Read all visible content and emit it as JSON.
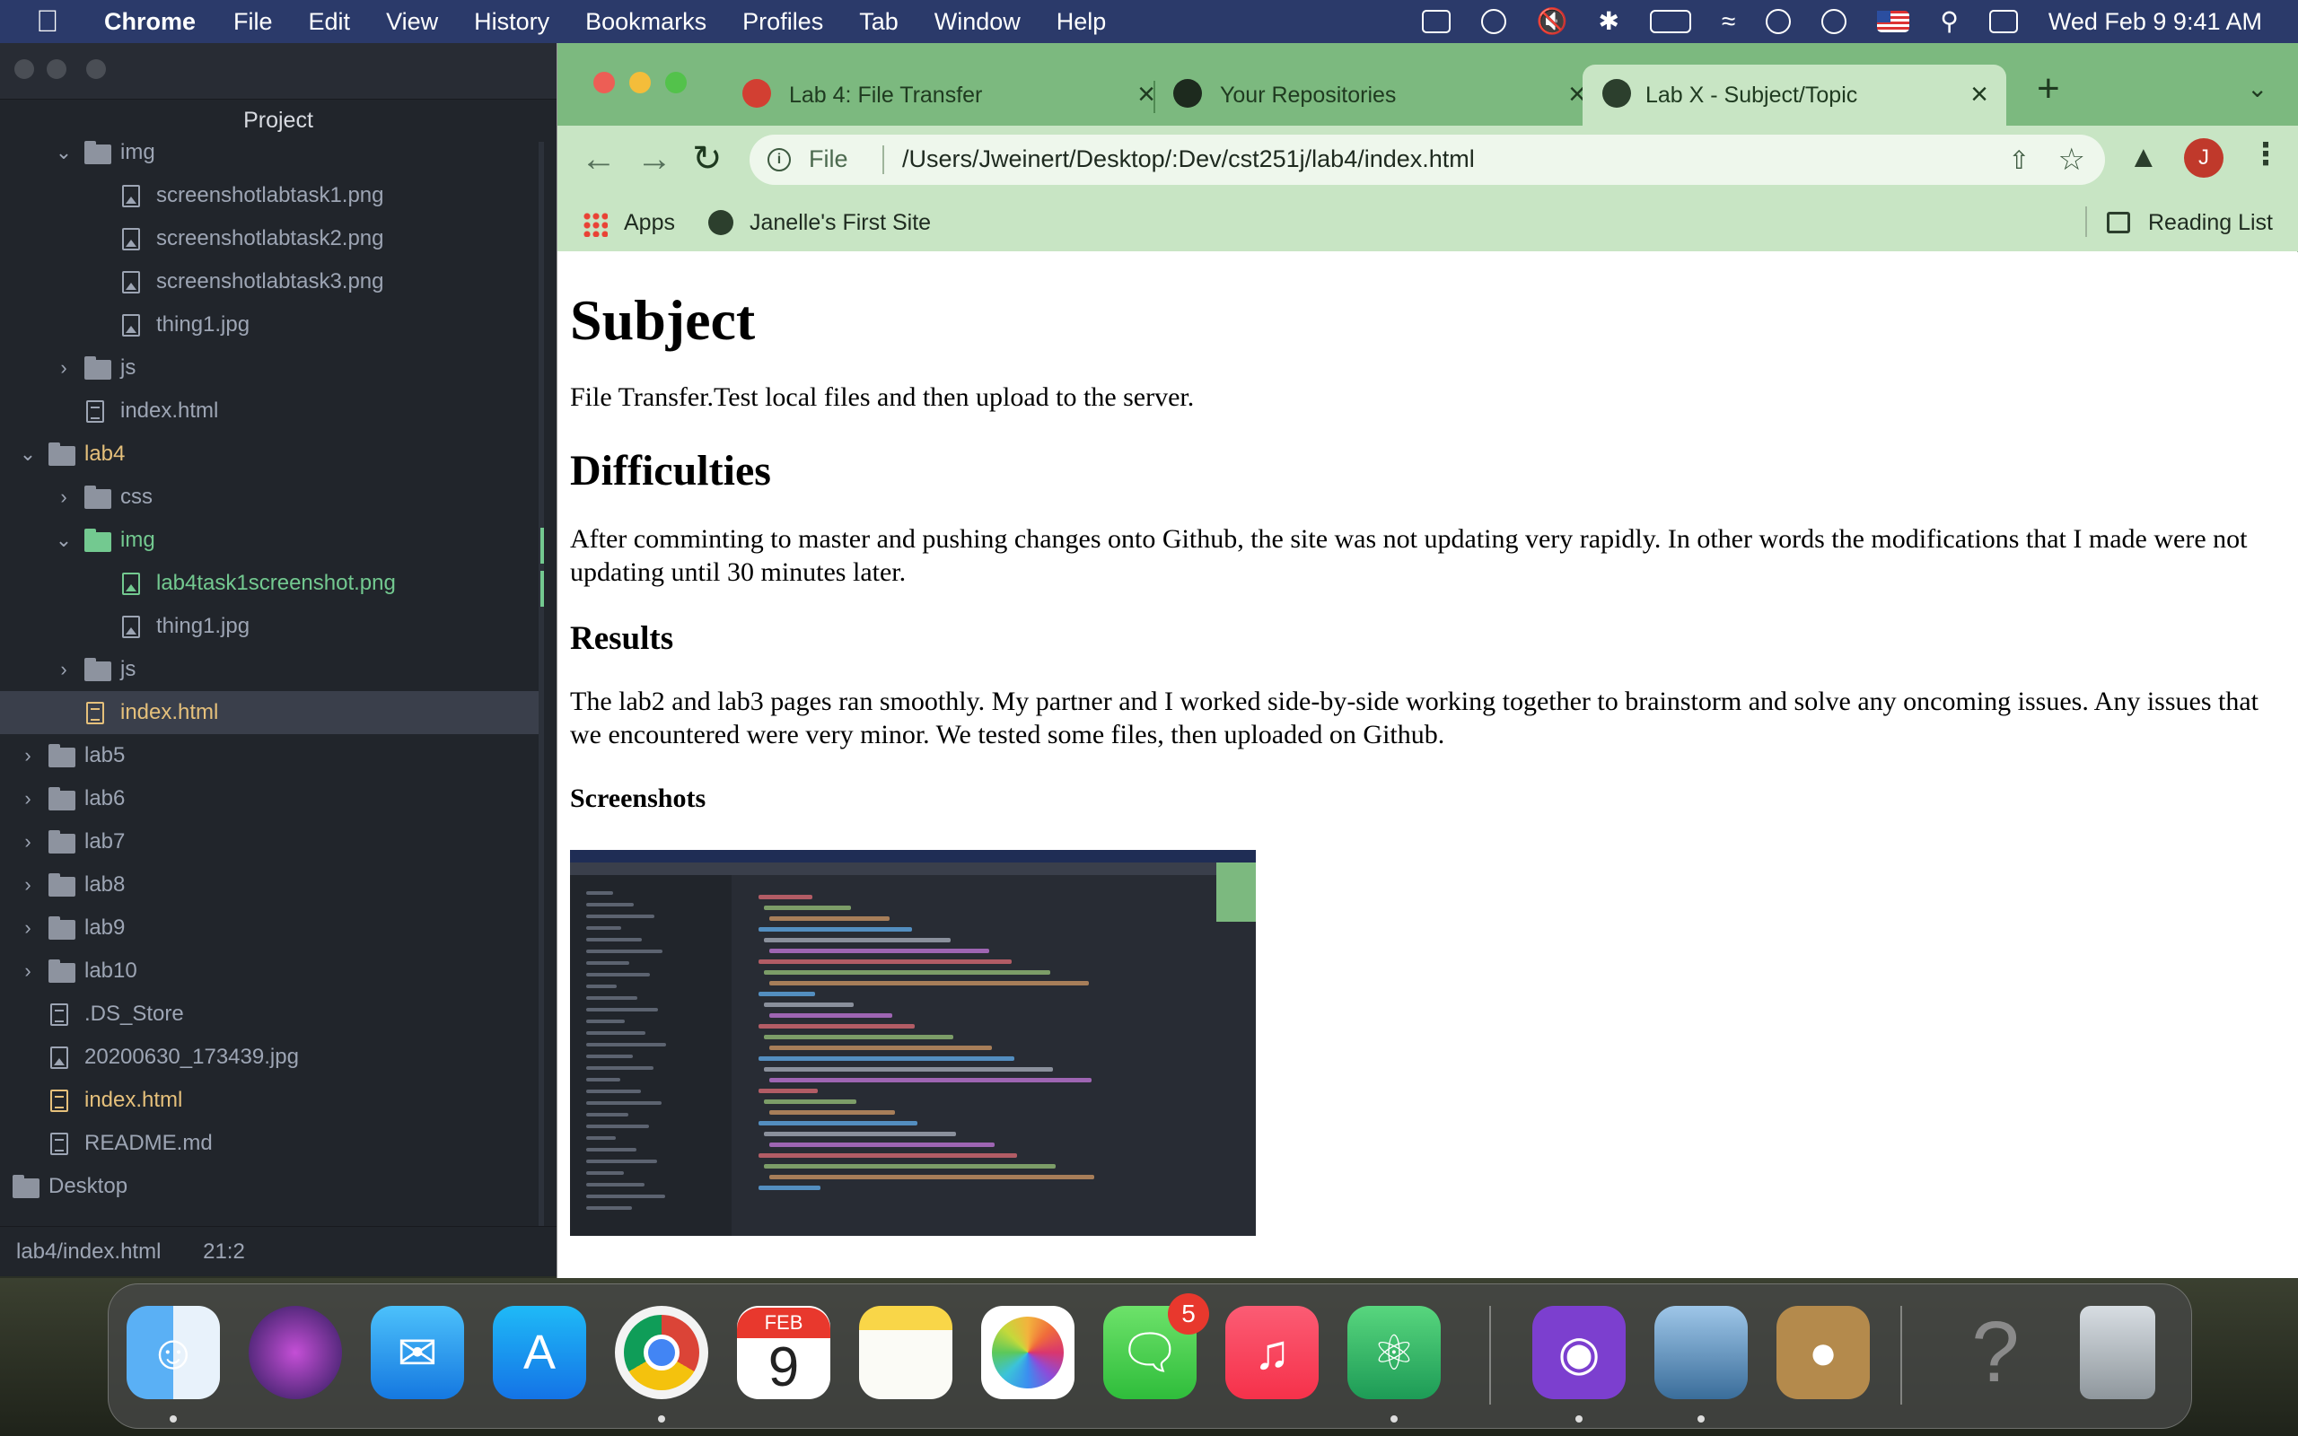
{
  "menubar": {
    "app_name": "Chrome",
    "items": [
      "File",
      "Edit",
      "View",
      "History",
      "Bookmarks",
      "Profiles",
      "Tab",
      "Window",
      "Help"
    ],
    "clock": "Wed Feb 9  9:41 AM"
  },
  "atom": {
    "panel_title": "Project",
    "tree": [
      {
        "label": "img",
        "kind": "folder",
        "depth": 1,
        "expanded": true
      },
      {
        "label": "screenshotlabtask1.png",
        "kind": "image",
        "depth": 2
      },
      {
        "label": "screenshotlabtask2.png",
        "kind": "image",
        "depth": 2
      },
      {
        "label": "screenshotlabtask3.png",
        "kind": "image",
        "depth": 2
      },
      {
        "label": "thing1.jpg",
        "kind": "image",
        "depth": 2
      },
      {
        "label": "js",
        "kind": "folder",
        "depth": 1,
        "expanded": false
      },
      {
        "label": "index.html",
        "kind": "text",
        "depth": 1
      },
      {
        "label": "lab4",
        "kind": "folder",
        "depth": 0,
        "expanded": true,
        "status": "modified"
      },
      {
        "label": "css",
        "kind": "folder",
        "depth": 1,
        "expanded": false
      },
      {
        "label": "img",
        "kind": "folder",
        "depth": 1,
        "expanded": true,
        "status": "added"
      },
      {
        "label": "lab4task1screenshot.png",
        "kind": "image",
        "depth": 2,
        "status": "added"
      },
      {
        "label": "thing1.jpg",
        "kind": "image",
        "depth": 2
      },
      {
        "label": "js",
        "kind": "folder",
        "depth": 1,
        "expanded": false
      },
      {
        "label": "index.html",
        "kind": "text",
        "depth": 1,
        "status": "modified",
        "selected": true
      },
      {
        "label": "lab5",
        "kind": "folder",
        "depth": 0,
        "expanded": false
      },
      {
        "label": "lab6",
        "kind": "folder",
        "depth": 0,
        "expanded": false
      },
      {
        "label": "lab7",
        "kind": "folder",
        "depth": 0,
        "expanded": false
      },
      {
        "label": "lab8",
        "kind": "folder",
        "depth": 0,
        "expanded": false
      },
      {
        "label": "lab9",
        "kind": "folder",
        "depth": 0,
        "expanded": false
      },
      {
        "label": "lab10",
        "kind": "folder",
        "depth": 0,
        "expanded": false
      },
      {
        "label": ".DS_Store",
        "kind": "text",
        "depth": 0
      },
      {
        "label": "20200630_173439.jpg",
        "kind": "image",
        "depth": 0
      },
      {
        "label": "index.html",
        "kind": "text",
        "depth": 0,
        "status": "modified"
      },
      {
        "label": "README.md",
        "kind": "readme",
        "depth": 0
      },
      {
        "label": "Desktop",
        "kind": "folder",
        "depth": -1,
        "expanded": true
      }
    ],
    "status_path": "lab4/index.html",
    "cursor_pos": "21:2"
  },
  "chrome": {
    "tabs": [
      {
        "label": "Lab 4: File Transfer",
        "active": false,
        "icon": "red-gear-icon"
      },
      {
        "label": "Your Repositories",
        "active": false,
        "icon": "github-icon"
      },
      {
        "label": "Lab X - Subject/Topic",
        "active": true,
        "icon": "globe-icon"
      }
    ],
    "omnibox": {
      "scheme": "File",
      "url": "/Users/Jweinert/Desktop/:Dev/cst251j/lab4/index.html"
    },
    "profile_initial": "J",
    "bookmarks": [
      "Apps",
      "Janelle's First Site"
    ],
    "reading_list": "Reading List"
  },
  "page": {
    "h1": "Subject",
    "p1": "File Transfer.Test local files and then upload to the server.",
    "h2": "Difficulties",
    "p2": "After comminting to master and pushing changes onto Github, the site was not updating very rapidly. In other words the modifications that I made were not updating until 30 minutes later.",
    "h3": "Results",
    "p3": "The lab2 and lab3 pages ran smoothly. My partner and I worked side-by-side working together to brainstorm and solve any oncoming issues. Any issues that we encountered were very minor. We tested some files, then uploaded on Github.",
    "h4": "Screenshots"
  },
  "dock": {
    "apps": [
      "finder",
      "siri",
      "mail",
      "app-store",
      "chrome",
      "calendar",
      "notes",
      "photos",
      "messages",
      "music",
      "atom",
      "github-desktop",
      "preview",
      "contacts",
      "help",
      "trash"
    ],
    "calendar_month": "FEB",
    "calendar_day": "9",
    "messages_badge": "5"
  },
  "colors": {
    "chrome_tabstrip": "#7cb97f",
    "chrome_toolbar": "#c8e5c4",
    "atom_bg": "#21252b",
    "git_added": "#73c990",
    "git_modified": "#e5c07b"
  }
}
